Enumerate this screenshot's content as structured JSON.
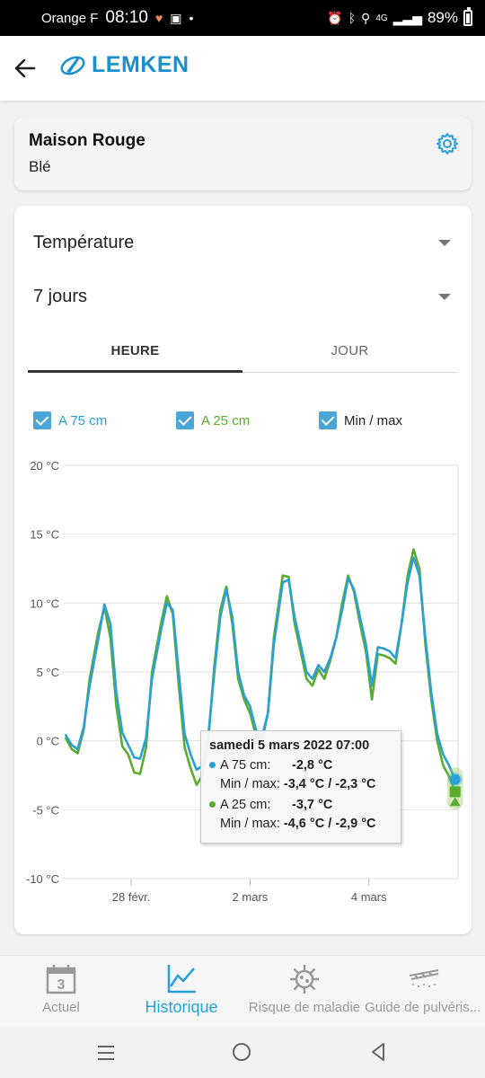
{
  "status_bar": {
    "carrier": "Orange F",
    "time": "08:10",
    "network": "4G",
    "battery": "89%"
  },
  "app_bar": {
    "logo_text": "LEMKEN"
  },
  "field": {
    "name": "Maison Rouge",
    "crop": "Blé"
  },
  "selectors": {
    "metric": "Température",
    "period": "7 jours"
  },
  "tabs": {
    "hour": "HEURE",
    "day": "JOUR",
    "active": "hour"
  },
  "legend": {
    "a75": "A 75 cm",
    "a25": "A 25 cm",
    "minmax": "Min / max"
  },
  "colors": {
    "a75": "#2b9fd6",
    "a25": "#5aac2e",
    "minmax_band": "#8cc455",
    "accent": "#29a0da",
    "brand": "#1a8fd0"
  },
  "chart_data": {
    "type": "line",
    "x_ticks": [
      "28 févr.",
      "2 mars",
      "4 mars"
    ],
    "y_ticks": [
      "20 °C",
      "15 °C",
      "10 °C",
      "5 °C",
      "0 °C",
      "-5 °C",
      "-10 °C"
    ],
    "ylim": [
      -10,
      20
    ],
    "x_unit": "days since 26 févr. 00:00",
    "xlim": [
      0.85,
      7.5
    ],
    "x_tick_values": [
      2,
      4,
      6
    ],
    "grid": true,
    "series": [
      {
        "name": "A 75 cm",
        "points": [
          [
            0.9,
            0.4
          ],
          [
            1.0,
            -0.3
          ],
          [
            1.1,
            -0.6
          ],
          [
            1.2,
            1.0
          ],
          [
            1.3,
            4.0
          ],
          [
            1.45,
            7.5
          ],
          [
            1.55,
            9.9
          ],
          [
            1.65,
            8.5
          ],
          [
            1.75,
            3.5
          ],
          [
            1.85,
            0.6
          ],
          [
            1.95,
            -0.3
          ],
          [
            2.05,
            -1.2
          ],
          [
            2.15,
            -1.3
          ],
          [
            2.25,
            0.2
          ],
          [
            2.35,
            4.5
          ],
          [
            2.5,
            8.0
          ],
          [
            2.6,
            10.0
          ],
          [
            2.7,
            9.5
          ],
          [
            2.8,
            5.0
          ],
          [
            2.9,
            0.5
          ],
          [
            3.0,
            -1.0
          ],
          [
            3.1,
            -2.1
          ],
          [
            3.2,
            -1.8
          ],
          [
            3.3,
            0.5
          ],
          [
            3.4,
            5.0
          ],
          [
            3.5,
            9.0
          ],
          [
            3.6,
            11.0
          ],
          [
            3.7,
            9.0
          ],
          [
            3.8,
            5.0
          ],
          [
            3.9,
            3.3
          ],
          [
            4.0,
            2.5
          ],
          [
            4.1,
            0.8
          ],
          [
            4.2,
            0.3
          ],
          [
            4.3,
            2.0
          ],
          [
            4.4,
            7.0
          ],
          [
            4.55,
            11.5
          ],
          [
            4.65,
            11.7
          ],
          [
            4.75,
            9.0
          ],
          [
            4.85,
            7.0
          ],
          [
            4.95,
            5.0
          ],
          [
            5.05,
            4.5
          ],
          [
            5.15,
            5.5
          ],
          [
            5.25,
            5.0
          ],
          [
            5.35,
            6.0
          ],
          [
            5.45,
            7.5
          ],
          [
            5.55,
            9.5
          ],
          [
            5.65,
            11.8
          ],
          [
            5.75,
            11.0
          ],
          [
            5.85,
            9.0
          ],
          [
            5.95,
            7.0
          ],
          [
            6.05,
            4.0
          ],
          [
            6.15,
            6.8
          ],
          [
            6.25,
            6.7
          ],
          [
            6.35,
            6.5
          ],
          [
            6.45,
            6.0
          ],
          [
            6.55,
            8.5
          ],
          [
            6.65,
            11.5
          ],
          [
            6.75,
            13.3
          ],
          [
            6.85,
            12.0
          ],
          [
            6.95,
            7.5
          ],
          [
            7.05,
            3.5
          ],
          [
            7.15,
            0.5
          ],
          [
            7.25,
            -1.0
          ],
          [
            7.35,
            -1.8
          ],
          [
            7.45,
            -2.8
          ]
        ]
      },
      {
        "name": "A 25 cm",
        "points": [
          [
            0.9,
            0.2
          ],
          [
            1.0,
            -0.6
          ],
          [
            1.1,
            -0.9
          ],
          [
            1.2,
            0.8
          ],
          [
            1.3,
            4.5
          ],
          [
            1.45,
            8.0
          ],
          [
            1.55,
            9.7
          ],
          [
            1.65,
            7.5
          ],
          [
            1.75,
            2.5
          ],
          [
            1.85,
            -0.4
          ],
          [
            1.95,
            -1.0
          ],
          [
            2.05,
            -2.3
          ],
          [
            2.15,
            -2.4
          ],
          [
            2.25,
            -0.5
          ],
          [
            2.35,
            5.0
          ],
          [
            2.5,
            8.5
          ],
          [
            2.6,
            10.5
          ],
          [
            2.7,
            9.2
          ],
          [
            2.8,
            4.0
          ],
          [
            2.9,
            -0.5
          ],
          [
            3.0,
            -2.0
          ],
          [
            3.1,
            -3.2
          ],
          [
            3.2,
            -2.5
          ],
          [
            3.3,
            0.2
          ],
          [
            3.4,
            5.5
          ],
          [
            3.5,
            9.5
          ],
          [
            3.6,
            11.2
          ],
          [
            3.7,
            8.5
          ],
          [
            3.8,
            4.5
          ],
          [
            3.9,
            3.0
          ],
          [
            4.0,
            2.0
          ],
          [
            4.1,
            0.4
          ],
          [
            4.2,
            0.0
          ],
          [
            4.3,
            2.0
          ],
          [
            4.4,
            7.5
          ],
          [
            4.55,
            12.0
          ],
          [
            4.65,
            11.9
          ],
          [
            4.75,
            8.5
          ],
          [
            4.85,
            6.5
          ],
          [
            4.95,
            4.5
          ],
          [
            5.05,
            4.0
          ],
          [
            5.15,
            5.2
          ],
          [
            5.25,
            4.5
          ],
          [
            5.35,
            5.8
          ],
          [
            5.45,
            7.5
          ],
          [
            5.55,
            10.0
          ],
          [
            5.65,
            12.0
          ],
          [
            5.75,
            10.8
          ],
          [
            5.85,
            8.5
          ],
          [
            5.95,
            6.5
          ],
          [
            6.05,
            3.0
          ],
          [
            6.15,
            6.3
          ],
          [
            6.25,
            6.2
          ],
          [
            6.35,
            6.0
          ],
          [
            6.45,
            5.6
          ],
          [
            6.55,
            8.5
          ],
          [
            6.65,
            12.0
          ],
          [
            6.75,
            13.9
          ],
          [
            6.85,
            12.5
          ],
          [
            6.95,
            7.0
          ],
          [
            7.05,
            3.0
          ],
          [
            7.15,
            0.0
          ],
          [
            7.25,
            -1.8
          ],
          [
            7.35,
            -2.6
          ],
          [
            7.45,
            -3.7
          ]
        ]
      }
    ],
    "minmax_band_last": [
      -4.6,
      -2.3
    ],
    "tooltip": {
      "title": "samedi 5 mars 2022 07:00",
      "a75_label": "A 75 cm:",
      "a75_value": "-2,8 °C",
      "a75_minmax_label": "Min / max:",
      "a75_minmax_value": "-3,4 °C / -2,3 °C",
      "a25_label": "A 25 cm:",
      "a25_value": "-3,7 °C",
      "a25_minmax_label": "Min / max:",
      "a25_minmax_value": "-4,6 °C / -2,9 °C"
    }
  },
  "bottom_nav": {
    "items": [
      {
        "label": "Actuel",
        "icon": "calendar-icon",
        "icon_text": "3"
      },
      {
        "label": "Historique",
        "icon": "chart-line-icon"
      },
      {
        "label": "Risque de maladie",
        "icon": "virus-icon"
      },
      {
        "label": "Guide de pulvéris...",
        "icon": "sprayer-icon"
      }
    ],
    "active": 1
  }
}
